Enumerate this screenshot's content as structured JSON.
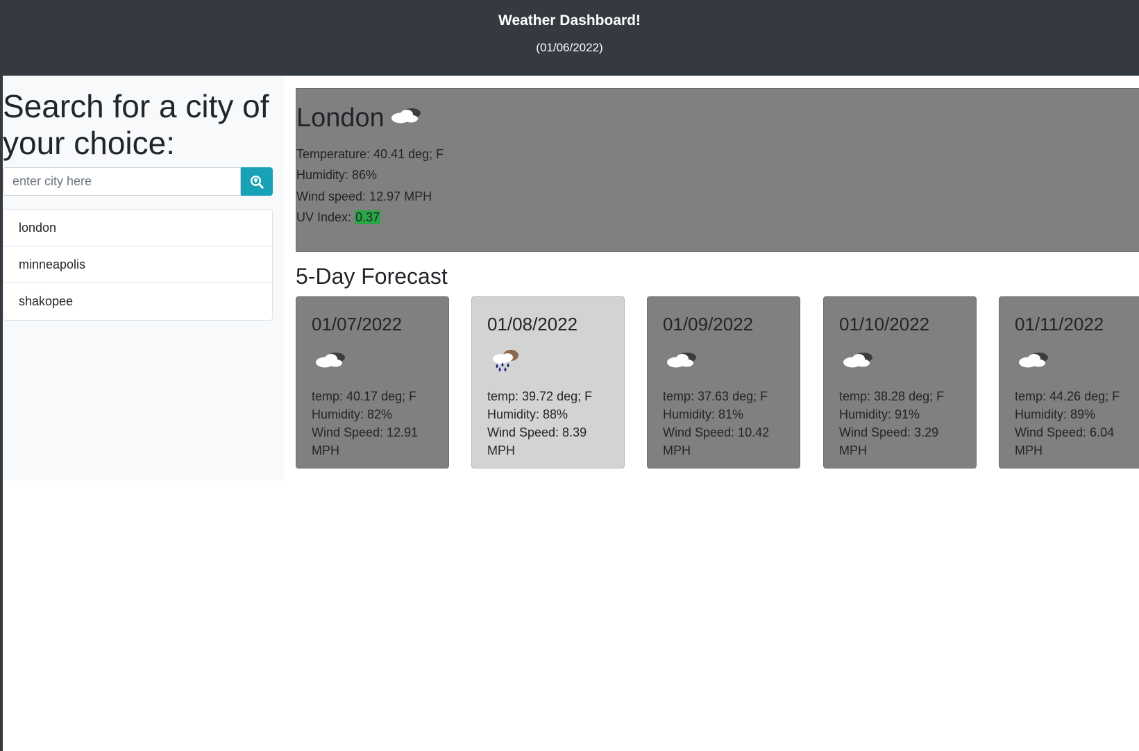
{
  "header": {
    "title": "Weather Dashboard!",
    "date": "(01/06/2022)"
  },
  "sidebar": {
    "heading": "Search for a city of your choice:",
    "search": {
      "placeholder": "enter city here",
      "value": ""
    },
    "search_button_icon": "search-location-icon",
    "history": [
      "london",
      "minneapolis",
      "shakopee"
    ]
  },
  "current": {
    "city": "London",
    "icon": "cloud-icon",
    "temperature": "Temperature: 40.41 deg; F",
    "humidity": "Humidity: 86%",
    "wind": "Wind speed: 12.97 MPH",
    "uv_label": "UV Index: ",
    "uv_value": "0.37",
    "uv_color": "#28a745"
  },
  "forecast": {
    "heading": "5-Day Forecast",
    "days": [
      {
        "date": "01/07/2022",
        "icon": "cloud-icon",
        "temp": "temp: 40.17 deg; F",
        "humidity": "Humidity: 82%",
        "wind": "Wind Speed: 12.91 MPH",
        "highlight": false
      },
      {
        "date": "01/08/2022",
        "icon": "rain-cloud-icon",
        "temp": "temp: 39.72 deg; F",
        "humidity": "Humidity: 88%",
        "wind": "Wind Speed: 8.39 MPH",
        "highlight": true
      },
      {
        "date": "01/09/2022",
        "icon": "cloud-icon",
        "temp": "temp: 37.63 deg; F",
        "humidity": "Humidity: 81%",
        "wind": "Wind Speed: 10.42 MPH",
        "highlight": false
      },
      {
        "date": "01/10/2022",
        "icon": "cloud-icon",
        "temp": "temp: 38.28 deg; F",
        "humidity": "Humidity: 91%",
        "wind": "Wind Speed: 3.29 MPH",
        "highlight": false
      },
      {
        "date": "01/11/2022",
        "icon": "cloud-icon",
        "temp": "temp: 44.26 deg; F",
        "humidity": "Humidity: 89%",
        "wind": "Wind Speed: 6.04 MPH",
        "highlight": false
      }
    ]
  },
  "colors": {
    "header_bg": "#343a40",
    "sidebar_bg": "#f8f9fa",
    "button_accent": "#17a2b8",
    "card_bg": "#808080",
    "card_highlight_bg": "#d3d3d3"
  }
}
